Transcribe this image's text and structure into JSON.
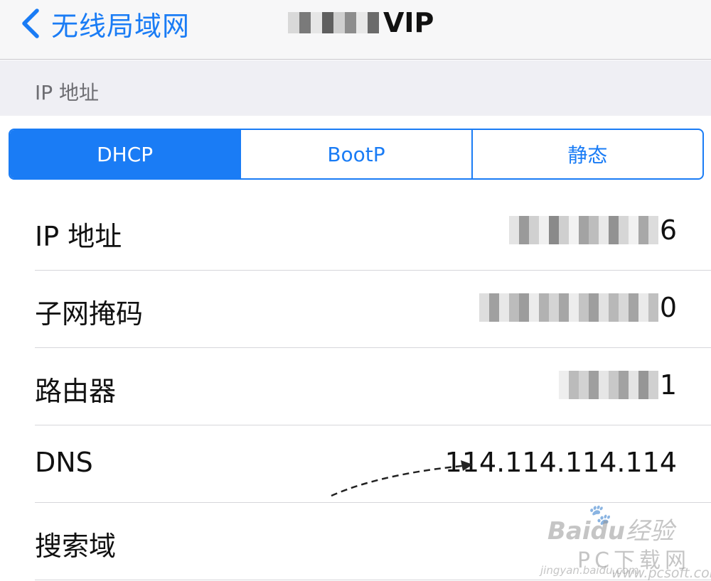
{
  "navbar": {
    "back_label": "无线局域网",
    "title_suffix": "VIP"
  },
  "section": {
    "label": "IP 地址"
  },
  "segments": [
    {
      "label": "DHCP",
      "selected": true
    },
    {
      "label": "BootP",
      "selected": false
    },
    {
      "label": "静态",
      "selected": false
    }
  ],
  "rows": [
    {
      "label": "IP 地址",
      "value_visible": "6"
    },
    {
      "label": "子网掩码",
      "value_visible": "0"
    },
    {
      "label": "路由器",
      "value_visible": "1"
    },
    {
      "label": "DNS",
      "value_visible": "114.114.114.114"
    },
    {
      "label": "搜索域",
      "value_visible": ""
    }
  ],
  "watermark": {
    "brand": "Baidu",
    "site_cn": "经验",
    "pc_text": "PC下载网",
    "url_jingyan": "jingyan.baidu.com",
    "url_pcsoft": "www.pcsoft.com.cn"
  },
  "colors": {
    "accent": "#1a7cf5",
    "nav_bg": "#f7f7f8",
    "section_bg": "#efeff4",
    "separator": "#d6d6da"
  }
}
